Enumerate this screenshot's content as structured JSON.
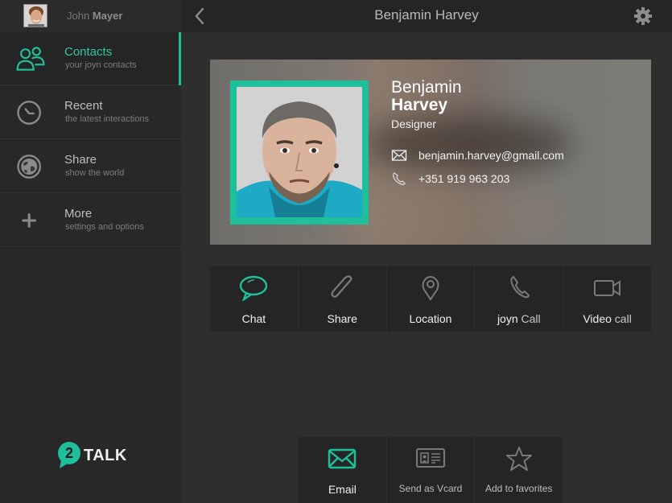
{
  "user": {
    "first_name": "John",
    "last_name": "Mayer",
    "avatar_icon": "user-avatar"
  },
  "accent_color": "#1fbf9b",
  "sidebar": {
    "items": [
      {
        "label": "Contacts",
        "sub": "your joyn contacts",
        "icon": "contacts-icon",
        "active": true
      },
      {
        "label": "Recent",
        "sub": "the latest interactions",
        "icon": "clock-icon",
        "active": false
      },
      {
        "label": "Share",
        "sub": "show  the world",
        "icon": "globe-icon",
        "active": false
      },
      {
        "label": "More",
        "sub": "settings and options",
        "icon": "plus-icon",
        "active": false
      }
    ],
    "logo": {
      "badge": "2",
      "text": "TALK"
    }
  },
  "header": {
    "title": "Benjamin Harvey",
    "back_icon": "chevron-left-icon",
    "settings_icon": "gear-icon"
  },
  "profile": {
    "first_name": "Benjamin",
    "last_name": "Harvey",
    "role": "Designer",
    "email": "benjamin.harvey@gmail.com",
    "phone": "+351 919 963 203"
  },
  "actions": [
    {
      "label": "Chat",
      "icon": "chat-bubble-icon",
      "accent": true
    },
    {
      "label": "Share",
      "icon": "paperclip-icon",
      "accent": false
    },
    {
      "label": "Location",
      "icon": "map-pin-icon",
      "accent": false
    },
    {
      "label_bold": "joyn",
      "label_light": "Call",
      "icon": "phone-icon",
      "accent": false
    },
    {
      "label_bold": "Video",
      "label_light": "call",
      "icon": "video-camera-icon",
      "accent": false
    }
  ],
  "bottom_actions": [
    {
      "label": "Email",
      "icon": "envelope-icon",
      "accent": true
    },
    {
      "label": "Send as Vcard",
      "icon": "vcard-icon",
      "accent": false
    },
    {
      "label": "Add to favorites",
      "icon": "star-icon",
      "accent": false
    }
  ]
}
